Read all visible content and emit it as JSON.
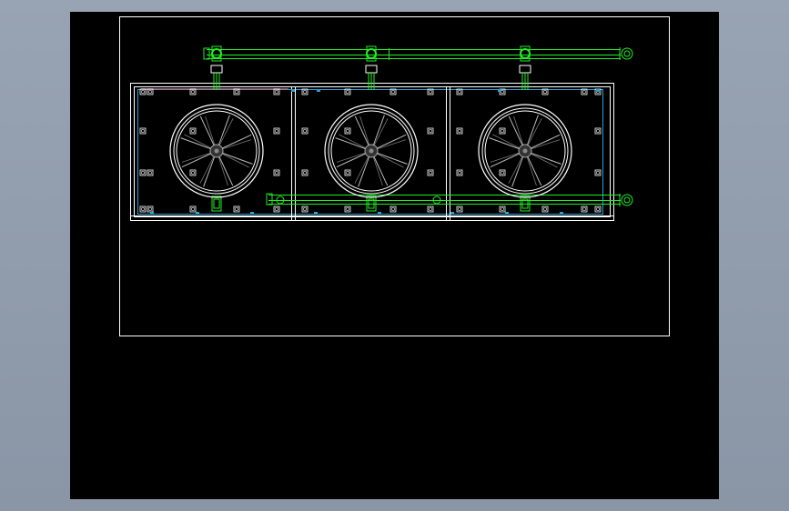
{
  "viewport": {
    "background": "#000000",
    "frame_color": "#ffffff",
    "pipe_color": "#22ee22",
    "cyan_color": "#2a9fd6",
    "red_color": "#e33030"
  },
  "drawing": {
    "fan_count": 3,
    "fan_blade_count": 8,
    "fan_icon": "axial-fan-icon",
    "valve_icon": "valve-icon",
    "bolt_icon": "bolt-square-icon"
  }
}
